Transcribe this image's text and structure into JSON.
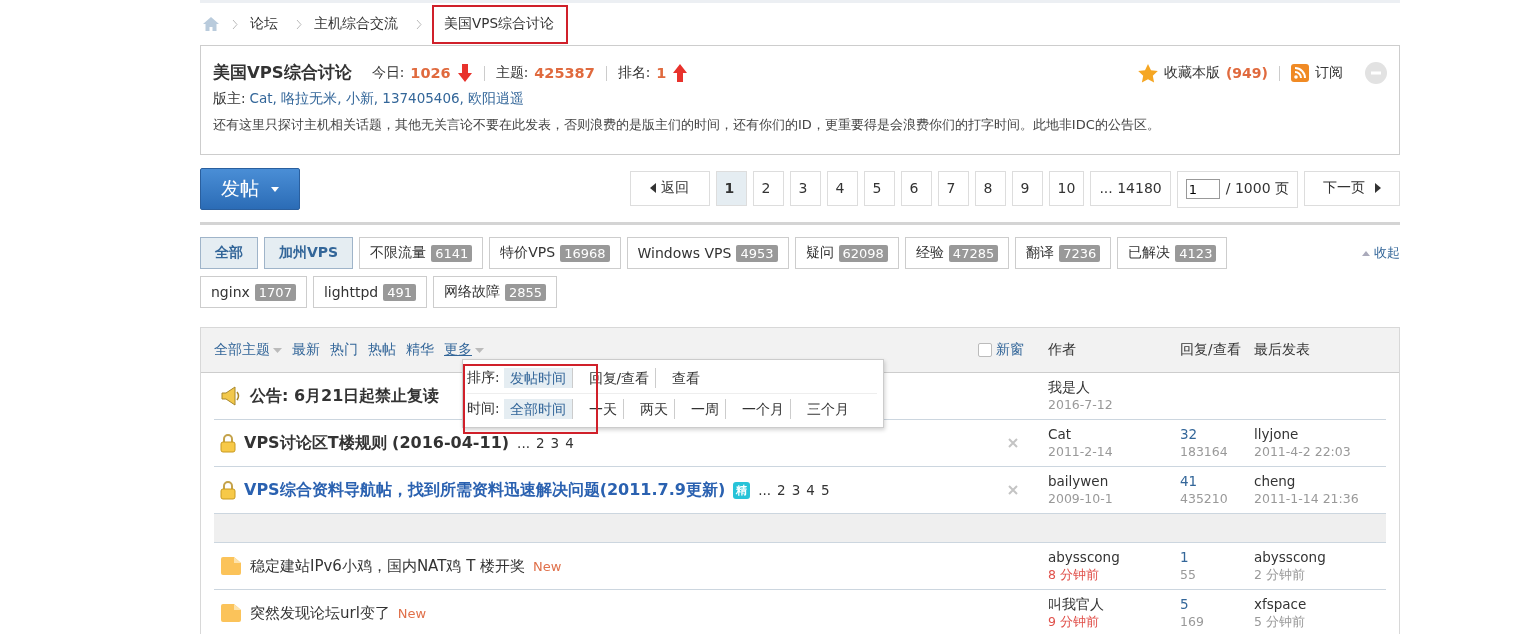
{
  "breadcrumb": [
    {
      "label": "论坛",
      "highlighted": false
    },
    {
      "label": "主机综合交流",
      "highlighted": false
    },
    {
      "label": "美国VPS综合讨论",
      "highlighted": true
    }
  ],
  "forum": {
    "name": "美国VPS综合讨论",
    "today_label": "今日:",
    "today": "1026",
    "topics_label": "主题:",
    "topics": "425387",
    "rank_label": "排名:",
    "rank": "1",
    "favorite": "收藏本版",
    "favorite_count": "(949)",
    "subscribe": "订阅",
    "moderators_label": "版主:",
    "moderators": "Cat, 咯拉无米, 小新, 137405406, 欧阳逍遥",
    "notice": "还有这里只探讨主机相关话题，其他无关言论不要在此发表，否则浪费的是版主们的时间，还有你们的ID，更重要得是会浪费你们的打字时间。此地非IDC的公告区。"
  },
  "post_button": "发帖",
  "pager": {
    "back": "返回",
    "pages": [
      {
        "label": "1",
        "selected": true
      },
      {
        "label": "2",
        "selected": false
      },
      {
        "label": "3",
        "selected": false
      },
      {
        "label": "4",
        "selected": false
      },
      {
        "label": "5",
        "selected": false
      },
      {
        "label": "6",
        "selected": false
      },
      {
        "label": "7",
        "selected": false
      },
      {
        "label": "8",
        "selected": false
      },
      {
        "label": "9",
        "selected": false
      },
      {
        "label": "10",
        "selected": false
      },
      {
        "label": "... 14180",
        "selected": false
      }
    ],
    "page_input": "1",
    "total": "/ 1000 页",
    "next": "下一页"
  },
  "tags": [
    {
      "label": "全部",
      "selected": true
    },
    {
      "label": "加州VPS",
      "selected": true
    },
    {
      "label": "不限流量",
      "count": "6141",
      "selected": false
    },
    {
      "label": "特价VPS",
      "count": "16968",
      "selected": false
    },
    {
      "label": "Windows VPS",
      "count": "4953",
      "selected": false
    },
    {
      "label": "疑问",
      "count": "62098",
      "selected": false
    },
    {
      "label": "经验",
      "count": "47285",
      "selected": false
    },
    {
      "label": "翻译",
      "count": "7236",
      "selected": false
    },
    {
      "label": "已解决",
      "count": "4123",
      "selected": false
    },
    {
      "label": "nginx",
      "count": "1707",
      "selected": false
    },
    {
      "label": "lighttpd",
      "count": "491",
      "selected": false
    },
    {
      "label": "网络故障",
      "count": "2855",
      "selected": false
    }
  ],
  "collapse": "收起",
  "filters": [
    {
      "label": "全部主题",
      "caret": true
    },
    {
      "label": "最新",
      "caret": false
    },
    {
      "label": "热门",
      "caret": false
    },
    {
      "label": "热帖",
      "caret": false
    },
    {
      "label": "精华",
      "caret": false
    },
    {
      "label": "更多",
      "caret": true
    }
  ],
  "new_window": {
    "label": "新窗",
    "checked": false
  },
  "columns": {
    "author": "作者",
    "stats": "回复/查看",
    "last": "最后发表"
  },
  "dropdown": {
    "highlighted": true,
    "rows": [
      {
        "label": "排序:",
        "options": [
          {
            "label": "发帖时间",
            "selected": true
          },
          {
            "label": "回复/查看",
            "selected": false
          },
          {
            "label": "查看",
            "selected": false
          }
        ]
      },
      {
        "label": "时间:",
        "options": [
          {
            "label": "全部时间",
            "selected": true
          },
          {
            "label": "一天",
            "selected": false
          },
          {
            "label": "两天",
            "selected": false
          },
          {
            "label": "一周",
            "selected": false
          },
          {
            "label": "一个月",
            "selected": false
          },
          {
            "label": "三个月",
            "selected": false
          }
        ]
      }
    ]
  },
  "threads": [
    {
      "kind": "announce",
      "title": "公告: 6月21日起禁止复读",
      "author": "我是人",
      "date": "2016-7-12",
      "recent": false
    },
    {
      "kind": "locked",
      "title": "VPS讨论区T楼规则 (2016-04-11)",
      "digest": false,
      "pages": [
        "...",
        "2",
        "3",
        "4"
      ],
      "author": "Cat",
      "date": "2011-2-14",
      "recent": false,
      "replies": "32",
      "views": "183164",
      "last_user": "llyjone",
      "last_time": "2011-4-2 22:03"
    },
    {
      "kind": "locked",
      "title": "VPS综合资料导航帖，找到所需资料迅速解决问题(2011.7.9更新)",
      "highlighted": true,
      "digest": "精",
      "pages": [
        "...",
        "2",
        "3",
        "4",
        "5"
      ],
      "author": "bailywen",
      "date": "2009-10-1",
      "recent": false,
      "replies": "41",
      "views": "435210",
      "last_user": "cheng",
      "last_time": "2011-1-14 21:36"
    },
    {
      "kind": "separator"
    },
    {
      "kind": "normal",
      "title": "稳定建站IPv6小鸡，国内NAT鸡 T 楼开奖",
      "badge": "New",
      "author": "abysscong",
      "date": "8 分钟前",
      "recent": true,
      "replies": "1",
      "views": "55",
      "last_user": "abysscong",
      "last_time": "2 分钟前"
    },
    {
      "kind": "normal",
      "title": "突然发现论坛url变了",
      "badge": "New",
      "author": "叫我官人",
      "date": "9 分钟前",
      "recent": true,
      "replies": "5",
      "views": "169",
      "last_user": "xfspace",
      "last_time": "5 分钟前"
    }
  ]
}
